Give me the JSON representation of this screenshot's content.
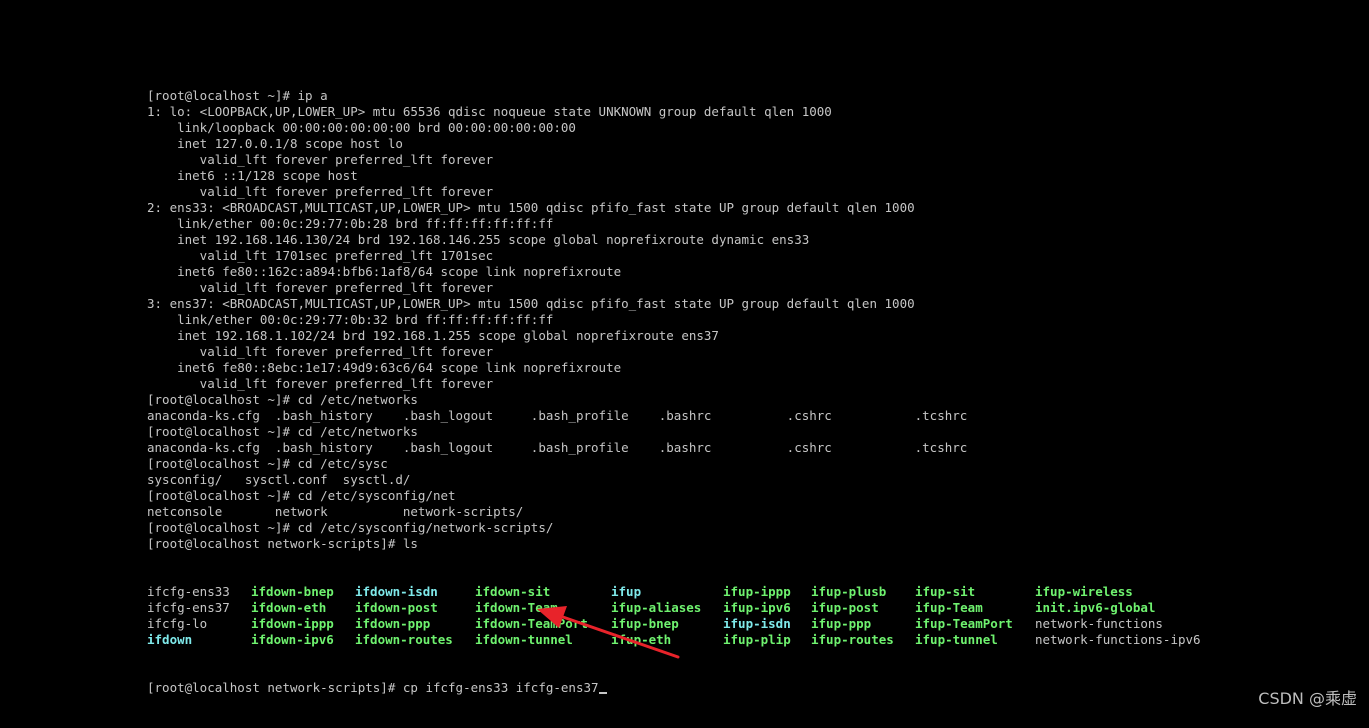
{
  "terminal": {
    "lines": [
      "[root@localhost ~]# ip a",
      "1: lo: <LOOPBACK,UP,LOWER_UP> mtu 65536 qdisc noqueue state UNKNOWN group default qlen 1000",
      "    link/loopback 00:00:00:00:00:00 brd 00:00:00:00:00:00",
      "    inet 127.0.0.1/8 scope host lo",
      "       valid_lft forever preferred_lft forever",
      "    inet6 ::1/128 scope host",
      "       valid_lft forever preferred_lft forever",
      "2: ens33: <BROADCAST,MULTICAST,UP,LOWER_UP> mtu 1500 qdisc pfifo_fast state UP group default qlen 1000",
      "    link/ether 00:0c:29:77:0b:28 brd ff:ff:ff:ff:ff:ff",
      "    inet 192.168.146.130/24 brd 192.168.146.255 scope global noprefixroute dynamic ens33",
      "       valid_lft 1701sec preferred_lft 1701sec",
      "    inet6 fe80::162c:a894:bfb6:1af8/64 scope link noprefixroute",
      "       valid_lft forever preferred_lft forever",
      "3: ens37: <BROADCAST,MULTICAST,UP,LOWER_UP> mtu 1500 qdisc pfifo_fast state UP group default qlen 1000",
      "    link/ether 00:0c:29:77:0b:32 brd ff:ff:ff:ff:ff:ff",
      "    inet 192.168.1.102/24 brd 192.168.1.255 scope global noprefixroute ens37",
      "       valid_lft forever preferred_lft forever",
      "    inet6 fe80::8ebc:1e17:49d9:63c6/64 scope link noprefixroute",
      "       valid_lft forever preferred_lft forever",
      "[root@localhost ~]# cd /etc/networks",
      "anaconda-ks.cfg  .bash_history    .bash_logout     .bash_profile    .bashrc          .cshrc           .tcshrc",
      "[root@localhost ~]# cd /etc/networks",
      "anaconda-ks.cfg  .bash_history    .bash_logout     .bash_profile    .bashrc          .cshrc           .tcshrc",
      "[root@localhost ~]# cd /etc/sysc",
      "sysconfig/   sysctl.conf  sysctl.d/",
      "[root@localhost ~]# cd /etc/sysconfig/net",
      "netconsole       network          network-scripts/",
      "[root@localhost ~]# cd /etc/sysconfig/network-scripts/",
      "[root@localhost network-scripts]# ls"
    ],
    "ls_rows": [
      [
        {
          "text": "ifcfg-ens33",
          "color": "plain"
        },
        {
          "text": "ifdown-bnep",
          "color": "green"
        },
        {
          "text": "ifdown-isdn",
          "color": "cyan"
        },
        {
          "text": "ifdown-sit",
          "color": "green"
        },
        {
          "text": "ifup",
          "color": "cyan"
        },
        {
          "text": "ifup-ippp",
          "color": "green"
        },
        {
          "text": "ifup-plusb",
          "color": "green"
        },
        {
          "text": "ifup-sit",
          "color": "green"
        },
        {
          "text": "ifup-wireless",
          "color": "green"
        }
      ],
      [
        {
          "text": "ifcfg-ens37",
          "color": "plain"
        },
        {
          "text": "ifdown-eth",
          "color": "green"
        },
        {
          "text": "ifdown-post",
          "color": "green"
        },
        {
          "text": "ifdown-Team",
          "color": "green"
        },
        {
          "text": "ifup-aliases",
          "color": "green"
        },
        {
          "text": "ifup-ipv6",
          "color": "green"
        },
        {
          "text": "ifup-post",
          "color": "green"
        },
        {
          "text": "ifup-Team",
          "color": "green"
        },
        {
          "text": "init.ipv6-global",
          "color": "green"
        }
      ],
      [
        {
          "text": "ifcfg-lo",
          "color": "plain"
        },
        {
          "text": "ifdown-ippp",
          "color": "green"
        },
        {
          "text": "ifdown-ppp",
          "color": "green"
        },
        {
          "text": "ifdown-TeamPort",
          "color": "green"
        },
        {
          "text": "ifup-bnep",
          "color": "green"
        },
        {
          "text": "ifup-isdn",
          "color": "cyan"
        },
        {
          "text": "ifup-ppp",
          "color": "green"
        },
        {
          "text": "ifup-TeamPort",
          "color": "green"
        },
        {
          "text": "network-functions",
          "color": "plain"
        }
      ],
      [
        {
          "text": "ifdown",
          "color": "cyan"
        },
        {
          "text": "ifdown-ipv6",
          "color": "green"
        },
        {
          "text": "ifdown-routes",
          "color": "green"
        },
        {
          "text": "ifdown-tunnel",
          "color": "green"
        },
        {
          "text": "ifup-eth",
          "color": "green"
        },
        {
          "text": "ifup-plip",
          "color": "green"
        },
        {
          "text": "ifup-routes",
          "color": "green"
        },
        {
          "text": "ifup-tunnel",
          "color": "green"
        },
        {
          "text": "network-functions-ipv6",
          "color": "plain"
        }
      ]
    ],
    "prompt_line": "[root@localhost network-scripts]# cp ifcfg-ens33 ifcfg-ens37",
    "colors": {
      "background": "#000000",
      "text": "#c6c6c6",
      "green": "#6ff26f",
      "cyan": "#7fe9ea",
      "arrow": "#e8232a"
    }
  },
  "annotation": {
    "arrow_color": "#e8232a"
  },
  "watermark": {
    "text": "CSDN @乘虚"
  }
}
